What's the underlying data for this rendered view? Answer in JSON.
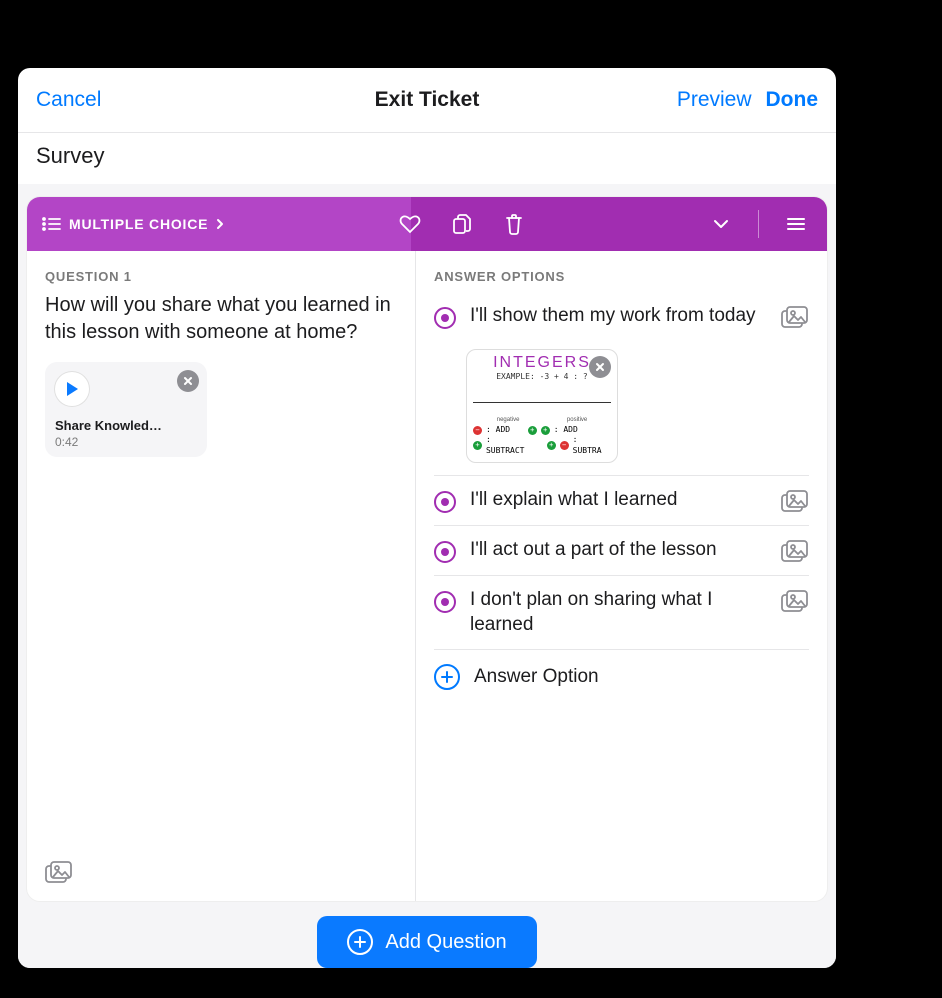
{
  "nav": {
    "cancel": "Cancel",
    "title": "Exit Ticket",
    "preview": "Preview",
    "done": "Done"
  },
  "survey_field": "Survey",
  "card": {
    "type_label": "MULTIPLE CHOICE",
    "question": {
      "label": "QUESTION 1",
      "text": "How will you share what you learned in this lesson with someone at home?",
      "media": {
        "name": "Share Knowled…",
        "duration": "0:42"
      }
    },
    "answers": {
      "label": "ANSWER OPTIONS",
      "options": [
        {
          "text": "I'll show them my work from today",
          "has_image": true
        },
        {
          "text": "I'll explain what I learned",
          "has_image": false
        },
        {
          "text": "I'll act out a part of the lesson",
          "has_image": false
        },
        {
          "text": "I don't plan on sharing what I learned",
          "has_image": false
        }
      ],
      "image_thumb": {
        "title": "INTEGERS",
        "subtitle": "EXAMPLE: -3 + 4 : ?",
        "left_label": "negative",
        "right_label": "positive",
        "row1_left": ": ADD",
        "row1_right": ": ADD",
        "row2_left": ": SUBTRACT",
        "row2_right": ": SUBTRA"
      },
      "add_option_label": "Answer Option"
    }
  },
  "add_question_label": "Add Question"
}
